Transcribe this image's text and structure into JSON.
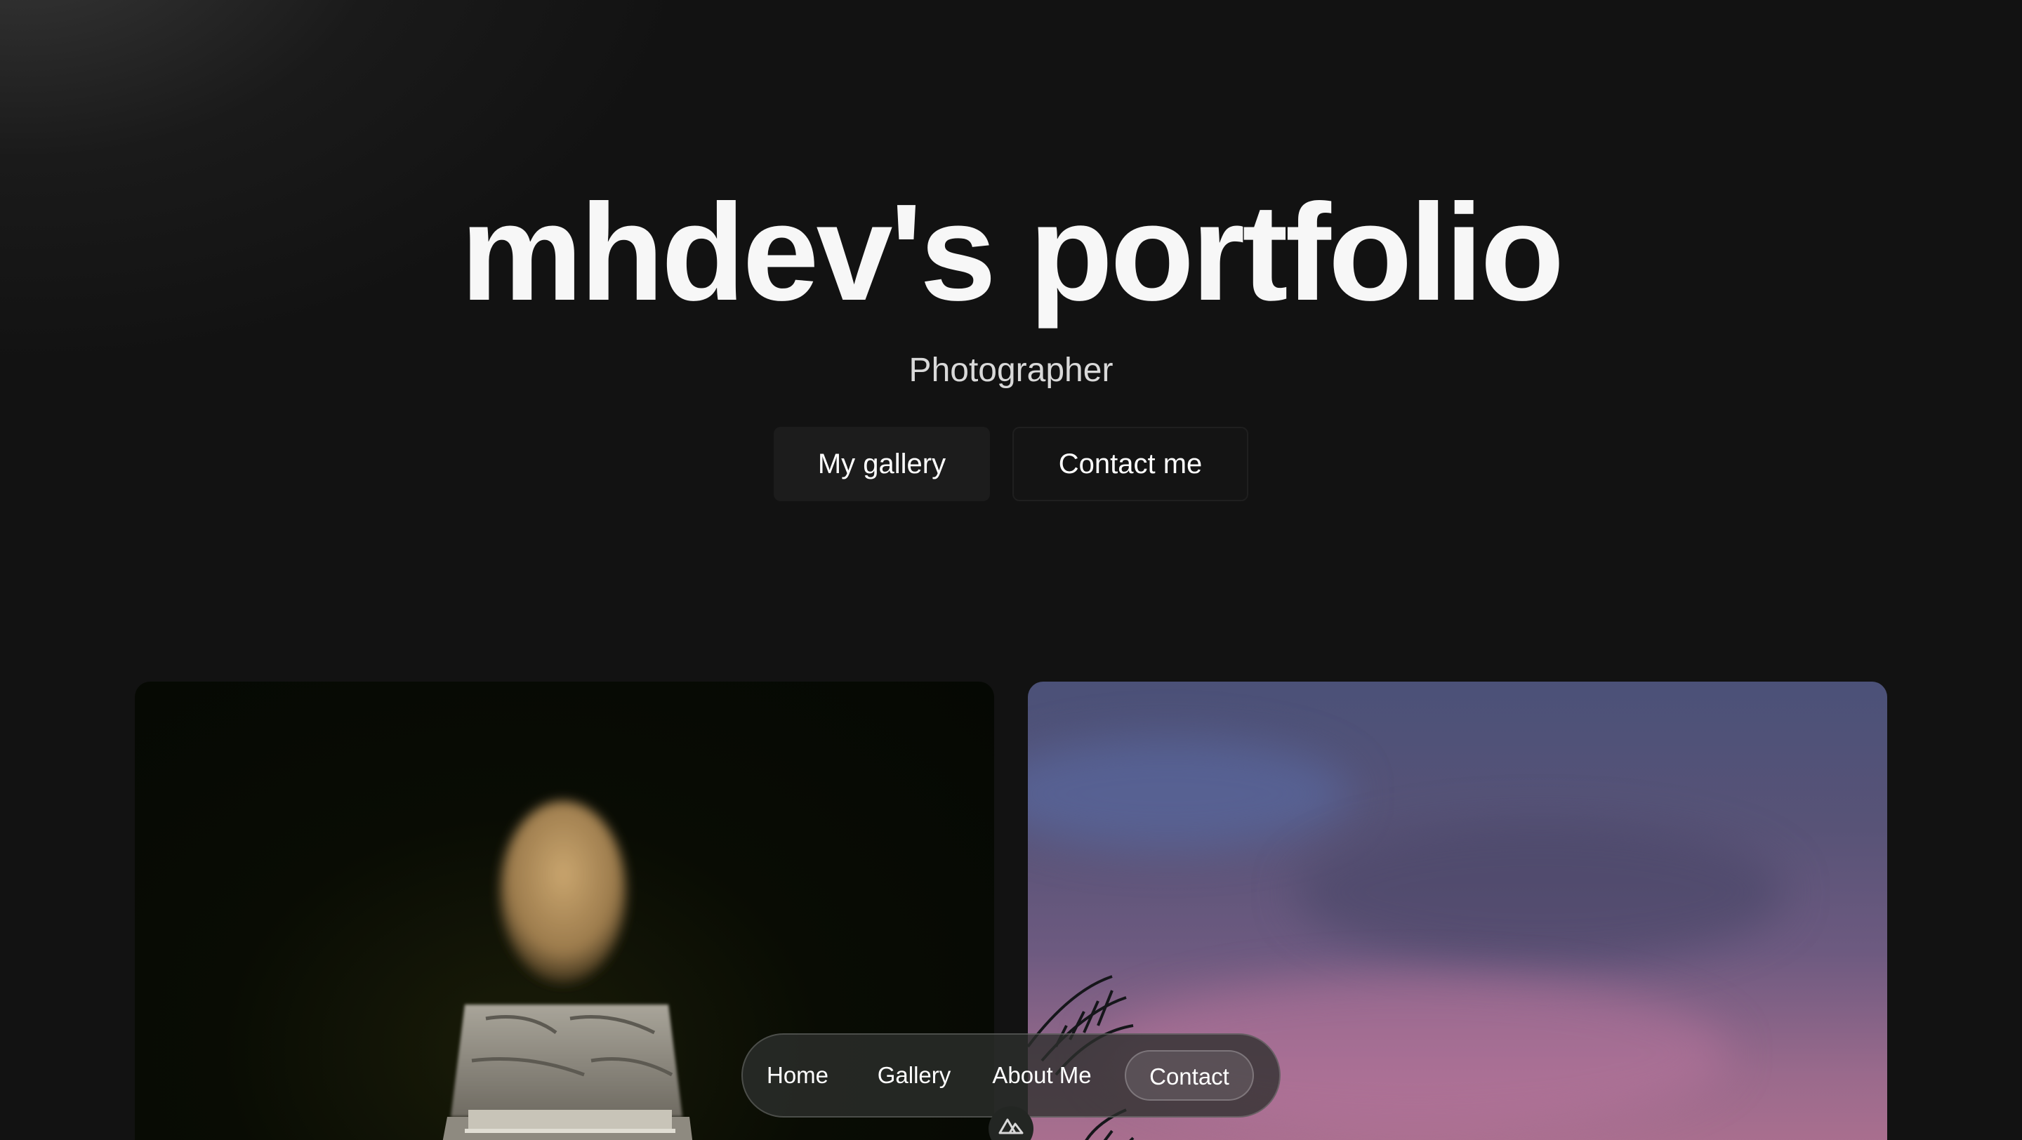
{
  "hero": {
    "title": "mhdev's portfolio",
    "subtitle": "Photographer",
    "primary_button": "My gallery",
    "secondary_button": "Contact me"
  },
  "gallery": {
    "images": [
      {
        "subject": "wristwatch-photo"
      },
      {
        "subject": "sunset-sky-palm-photo"
      }
    ]
  },
  "nav": {
    "items": [
      {
        "label": "Home"
      },
      {
        "label": "Gallery"
      },
      {
        "label": "About Me"
      },
      {
        "label": "Contact"
      }
    ],
    "active": "Contact"
  },
  "badge": {
    "icon": "nuxt-logo-icon"
  },
  "colors": {
    "background": "#121212",
    "text": "#f7f7f7",
    "subtitle": "#d9d9d9",
    "button": "#1c1c1c"
  }
}
